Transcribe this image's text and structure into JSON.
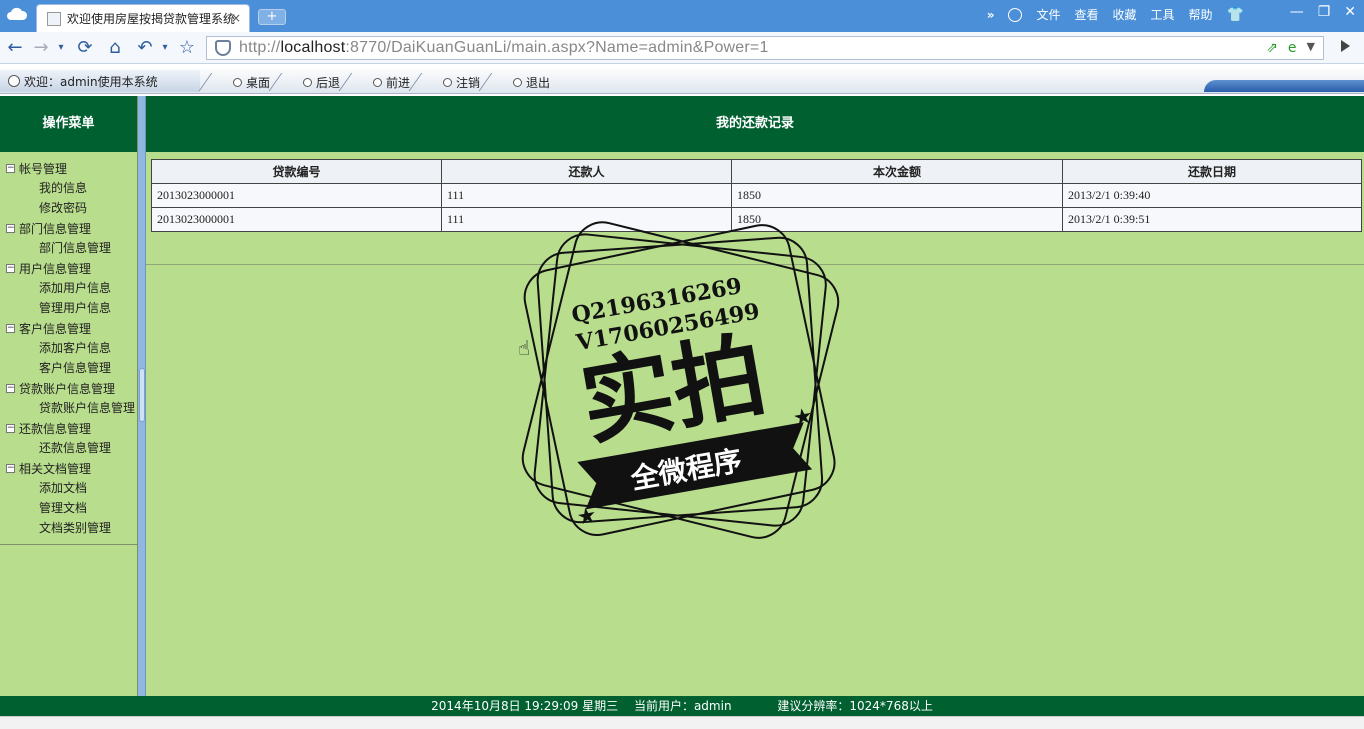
{
  "browser": {
    "tab_title": "欢迎使用房屋按揭贷款管理系统",
    "tab_close": "×",
    "new_tab": "+",
    "menu_more": "»",
    "menu": [
      "文件",
      "查看",
      "收藏",
      "工具",
      "帮助"
    ],
    "win_controls": [
      "—",
      "❐",
      "✕"
    ],
    "url_prefix": "http://",
    "url_host": "localhost",
    "url_rest": ":8770/DaiKuanGuanLi/main.aspx?Name=admin&Power=1"
  },
  "app_top": {
    "welcome": "欢迎：admin使用本系统",
    "nav": [
      "桌面",
      "后退",
      "前进",
      "注销",
      "退出"
    ]
  },
  "sidebar": {
    "title": "操作菜单",
    "groups": [
      {
        "label": "帐号管理",
        "items": [
          "我的信息",
          "修改密码"
        ]
      },
      {
        "label": "部门信息管理",
        "items": [
          "部门信息管理"
        ]
      },
      {
        "label": "用户信息管理",
        "items": [
          "添加用户信息",
          "管理用户信息"
        ]
      },
      {
        "label": "客户信息管理",
        "items": [
          "添加客户信息",
          "客户信息管理"
        ]
      },
      {
        "label": "贷款账户信息管理",
        "items": [
          "贷款账户信息管理"
        ]
      },
      {
        "label": "还款信息管理",
        "items": [
          "还款信息管理"
        ]
      },
      {
        "label": "相关文档管理",
        "items": [
          "添加文档",
          "管理文档",
          "文档类别管理"
        ]
      }
    ]
  },
  "main": {
    "title": "我的还款记录",
    "columns": [
      "贷款编号",
      "还款人",
      "本次金额",
      "还款日期"
    ],
    "rows": [
      [
        "2013023000001",
        "111",
        "1850",
        "2013/2/1 0:39:40"
      ],
      [
        "2013023000001",
        "111",
        "1850",
        "2013/2/1 0:39:51"
      ]
    ]
  },
  "watermark": {
    "line1": "Q2196316269",
    "line2": "V17060256499",
    "big": "实拍",
    "ribbon": "全微程序"
  },
  "footer": {
    "datetime": "2014年10月8日 19:29:09 星期三",
    "user": "当前用户：admin",
    "resolution": "建议分辨率：1024*768以上"
  }
}
